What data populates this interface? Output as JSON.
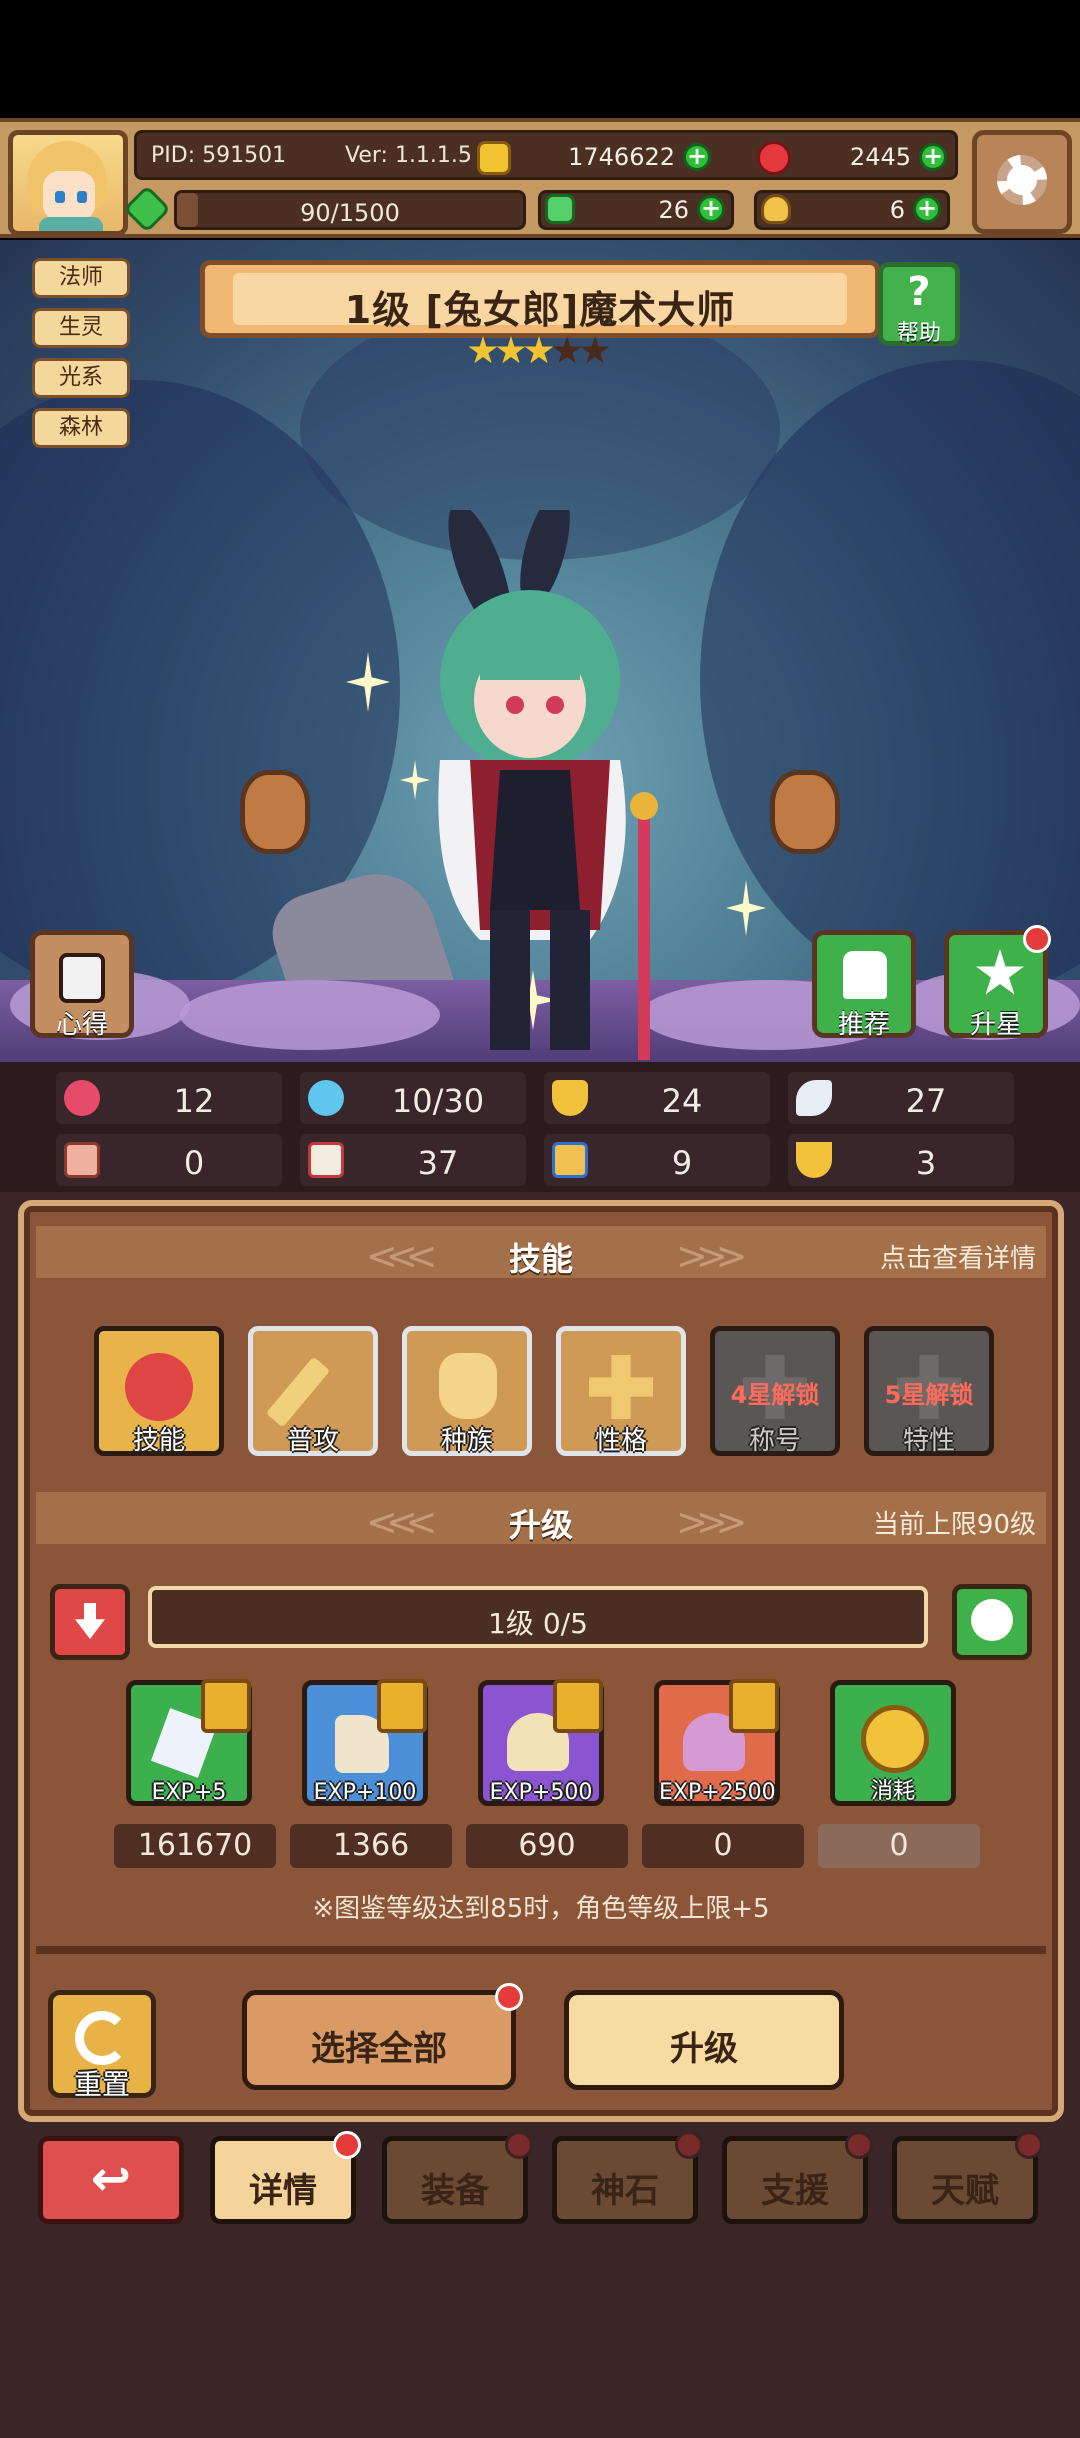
{
  "top_bar": {
    "pid": "PID: 591501",
    "version": "Ver: 1.1.1.5",
    "gold": "1746622",
    "gems": "2445",
    "stamina": "90/1500",
    "stamina_fraction": 0.06,
    "clover": "26",
    "potion": "6"
  },
  "tags": [
    "法师",
    "生灵",
    "光系",
    "森林"
  ],
  "character": {
    "title": "1级 [兔女郎]魔术大师",
    "stars_filled": 3,
    "stars_total": 5
  },
  "buttons": {
    "help": "帮助",
    "insight": "心得",
    "recommend": "推荐",
    "star_up": "升星"
  },
  "stats": [
    "12",
    "10/30",
    "24",
    "27",
    "0",
    "37",
    "9",
    "3"
  ],
  "skills_section": {
    "title": "技能",
    "hint": "点击查看详情",
    "items": [
      {
        "label": "技能",
        "lock": ""
      },
      {
        "label": "普攻",
        "lock": ""
      },
      {
        "label": "种族",
        "lock": ""
      },
      {
        "label": "性格",
        "lock": ""
      },
      {
        "label": "称号",
        "lock": "4星解锁"
      },
      {
        "label": "特性",
        "lock": "5星解锁"
      }
    ]
  },
  "upgrade_section": {
    "title": "升级",
    "hint": "当前上限90级",
    "level_bar": "1级  0/5",
    "items": [
      {
        "label": "EXP+5",
        "count": "161670"
      },
      {
        "label": "EXP+100",
        "count": "1366"
      },
      {
        "label": "EXP+500",
        "count": "690"
      },
      {
        "label": "EXP+2500",
        "count": "0"
      },
      {
        "label": "消耗",
        "count": "0"
      }
    ],
    "note": "※图鉴等级达到85时，角色等级上限+5"
  },
  "actions": {
    "reset": "重置",
    "select_all": "选择全部",
    "upgrade": "升级"
  },
  "tabs": [
    "详情",
    "装备",
    "神石",
    "支援",
    "天赋"
  ],
  "colors": {
    "accent_green": "#2fbf3a",
    "alert_red": "#e63b3b",
    "panel_brown": "#8a5538"
  }
}
